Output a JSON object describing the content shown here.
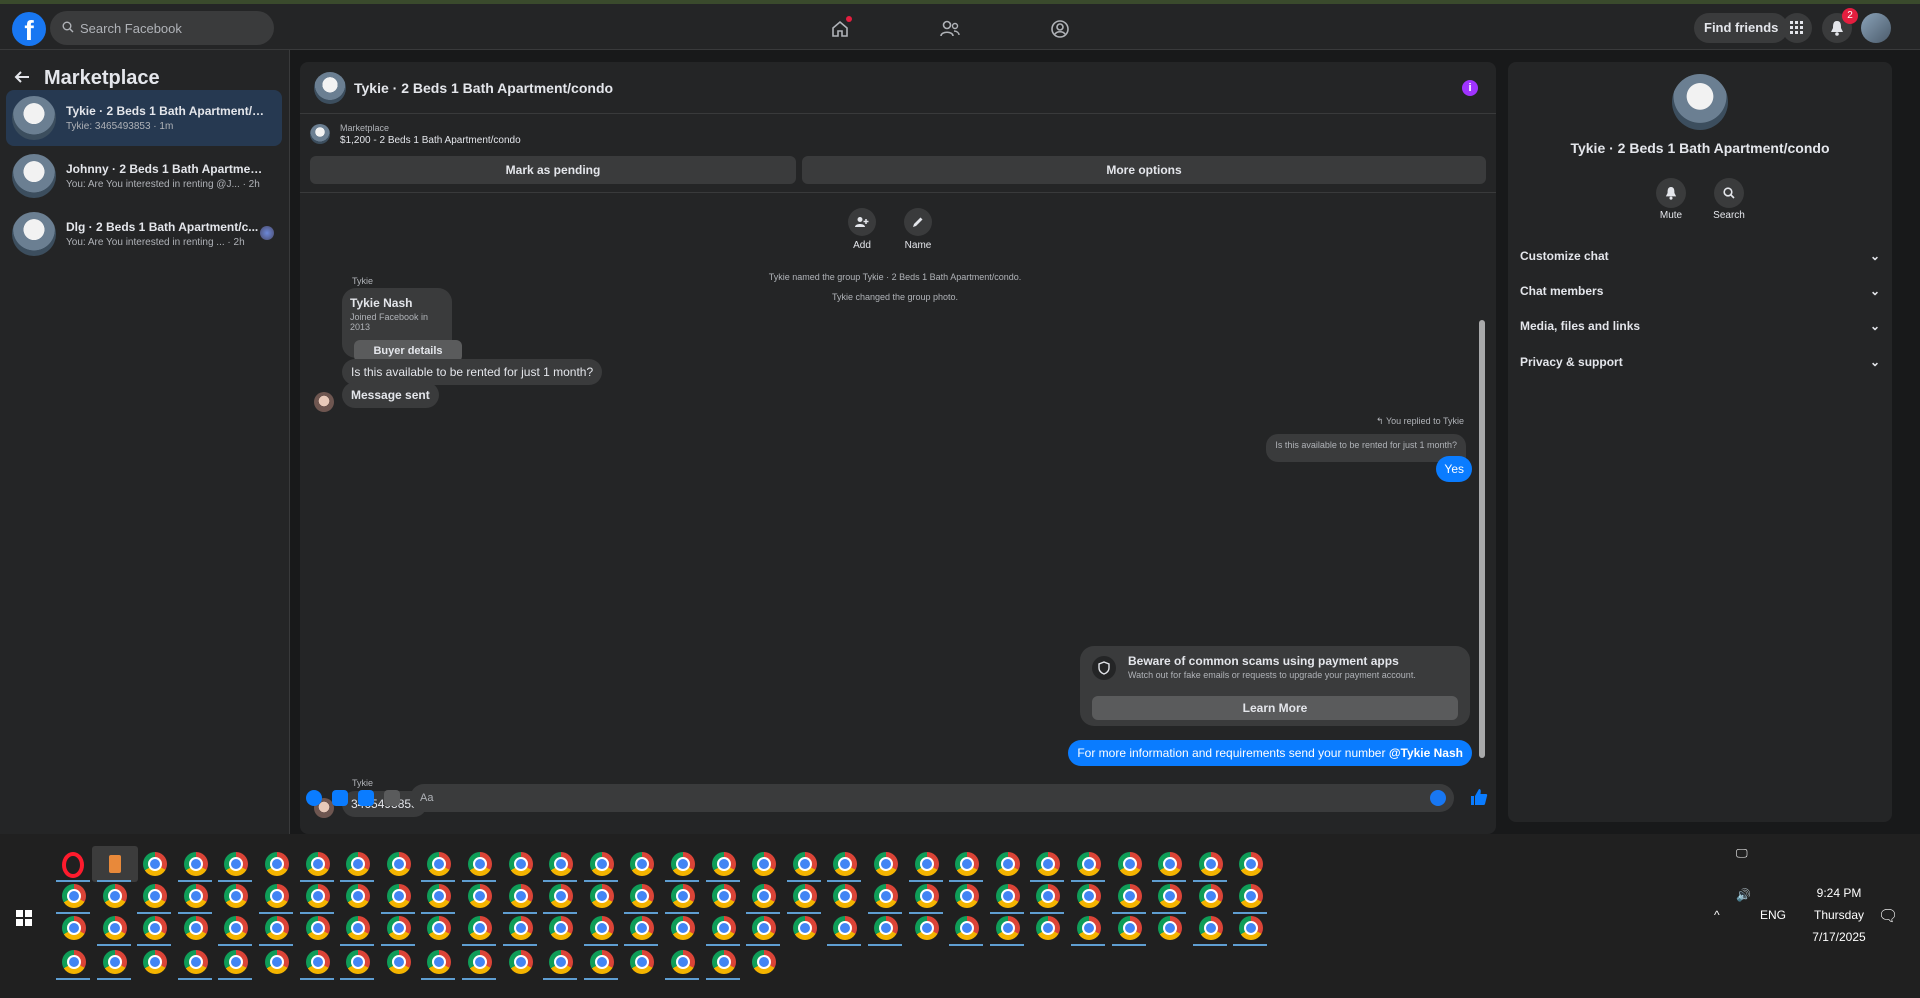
{
  "topbar": {
    "logo": "f",
    "search_placeholder": "Search Facebook",
    "find_friends": "Find friends",
    "notifications_count": "2"
  },
  "sidebar": {
    "title": "Marketplace",
    "conversations": [
      {
        "title": "Tykie · 2 Beds 1 Bath Apartment/c...",
        "preview": "Tykie: 3465493853 · 1m"
      },
      {
        "title": "Johnny · 2 Beds 1 Bath Apartment/...",
        "preview": "You: Are You interested in renting @J... · 2h"
      },
      {
        "title": "Dlg · 2 Beds 1 Bath Apartment/c...",
        "preview": "You: Are You interested in renting ... · 2h"
      }
    ]
  },
  "chat": {
    "title": "Tykie · 2 Beds 1 Bath Apartment/condo",
    "marketplace_label": "Marketplace",
    "listing": "$1,200 - 2 Beds 1 Bath Apartment/condo",
    "mark_pending": "Mark as pending",
    "more_options": "More options",
    "add_label": "Add",
    "name_label": "Name",
    "system_1": "Tykie named the group Tykie · 2 Beds 1 Bath Apartment/condo.",
    "system_2": "Tykie changed the group photo.",
    "sender_1": "Tykie",
    "profile_name": "Tykie Nash",
    "profile_joined": "Joined Facebook in 2013",
    "buyer_details": "Buyer details",
    "msg_1": "Is this available to be rented for just 1 month?",
    "msg_2": "Message sent",
    "replied_to": "You replied to Tykie",
    "quote": "Is this available to be rented for just 1 month?",
    "reply_yes": "Yes",
    "scam_title": "Beware of common scams using payment apps",
    "scam_sub": "Watch out for fake emails or requests to upgrade your payment account.",
    "learn_more": "Learn More",
    "msg_me_2": "For more information and requirements send your number ",
    "mention": "@Tykie Nash",
    "sender_2": "Tykie",
    "msg_3": "3465493853",
    "composer_placeholder": "Aa"
  },
  "details": {
    "title": "Tykie · 2 Beds 1 Bath Apartment/condo",
    "mute": "Mute",
    "search": "Search",
    "items": [
      "Customize chat",
      "Chat members",
      "Media, files and links",
      "Privacy & support"
    ]
  },
  "taskbar": {
    "lang": "ENG",
    "time": "9:24 PM",
    "day": "Thursday",
    "date": "7/17/2025"
  },
  "colors": {
    "accent": "#0a7cff",
    "brand": "#1877f2",
    "bg": "#18191a",
    "panel": "#242526"
  }
}
